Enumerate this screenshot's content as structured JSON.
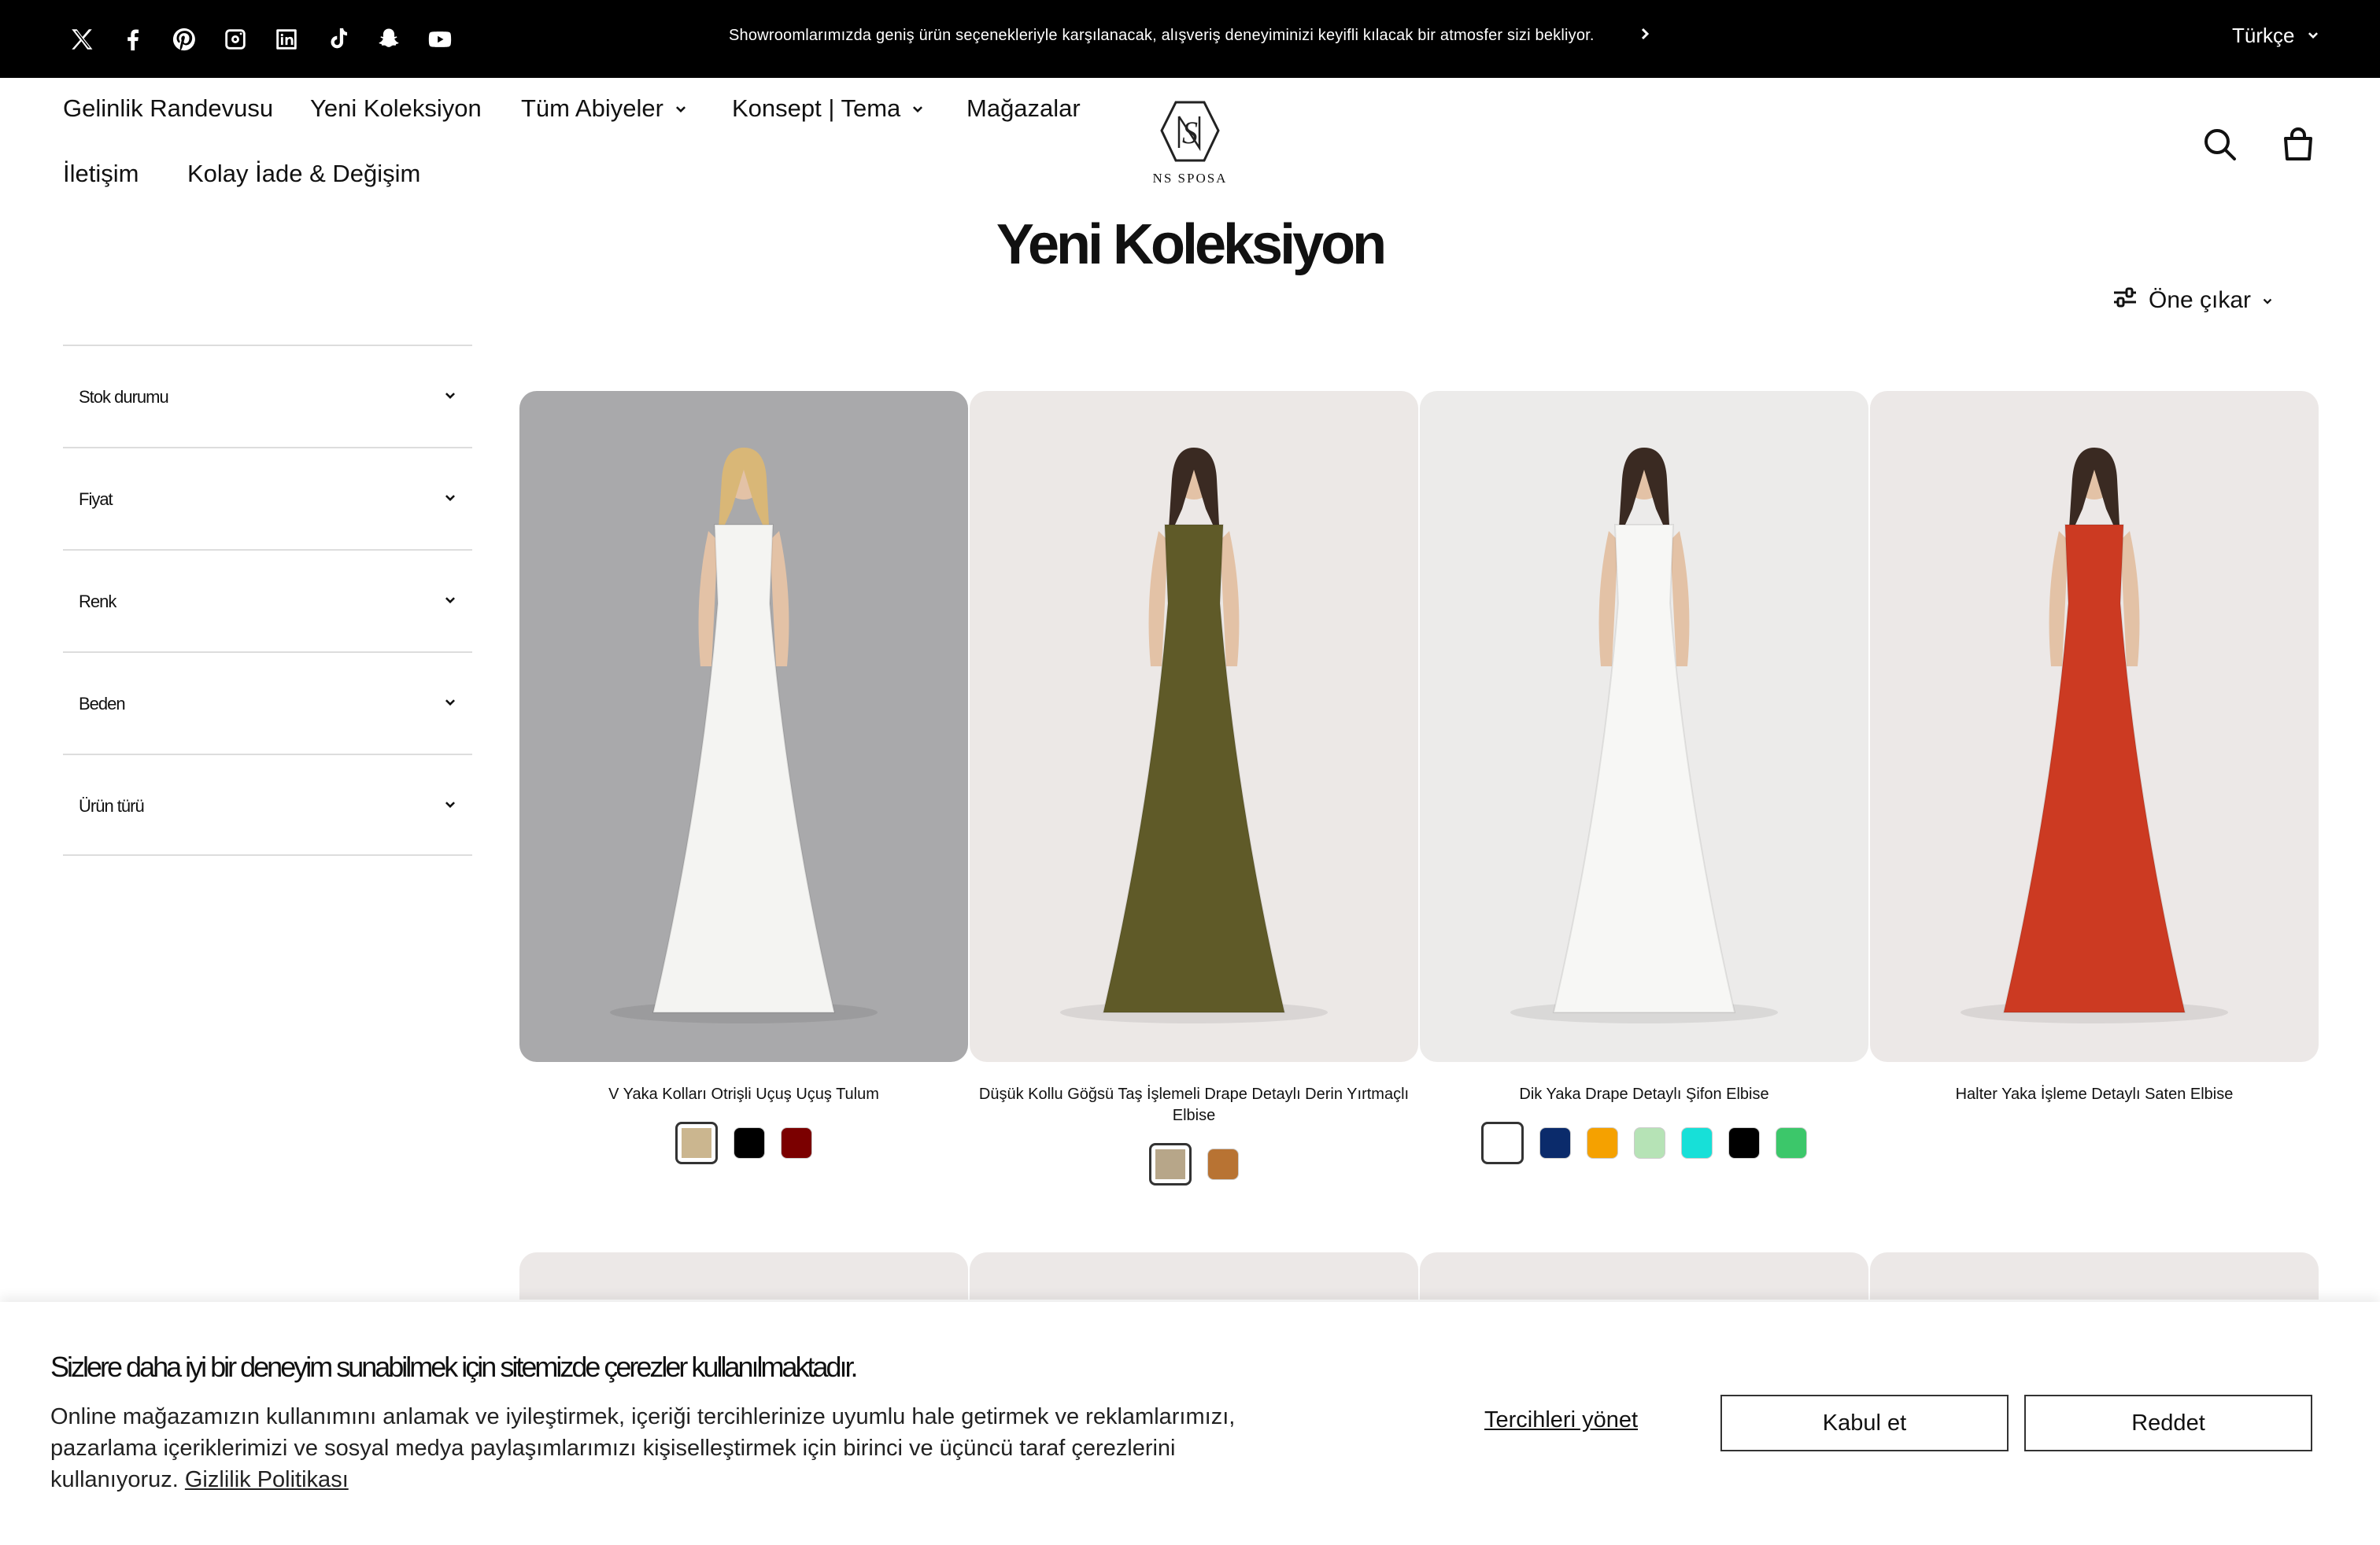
{
  "announcement": {
    "text": "Showroomlarımızda geniş ürün seçenekleriyle karşılanacak, alışveriş deneyiminizi keyifli kılacak bir atmosfer sizi bekliyor.",
    "language": "Türkçe"
  },
  "social": [
    "x-icon",
    "facebook-icon",
    "pinterest-icon",
    "instagram-icon",
    "linkedin-icon",
    "tiktok-icon",
    "snapchat-icon",
    "youtube-icon"
  ],
  "nav": {
    "items": [
      {
        "label": "Gelinlik Randevusu"
      },
      {
        "label": "Yeni Koleksiyon"
      },
      {
        "label": "Tüm Abiyeler"
      },
      {
        "label": "Konsept | Tema"
      },
      {
        "label": "Mağazalar"
      },
      {
        "label": "İletişim"
      },
      {
        "label": "Kolay İade & Değişim"
      }
    ]
  },
  "logo": {
    "text": "NS SPOSA"
  },
  "page": {
    "title": "Yeni Koleksiyon",
    "sort_label": "Öne çıkar"
  },
  "filters": [
    "Stok durumu",
    "Fiyat",
    "Renk",
    "Beden",
    "Ürün türü"
  ],
  "products": [
    {
      "title": "V Yaka Kolları Otrişli Uçuş Uçuş Tulum",
      "swatches": [
        "#cbb68f",
        "#000000",
        "#7b0000"
      ],
      "dress_color": "#f4f4f2",
      "bg": "#a9a9ab"
    },
    {
      "title": "Düşük Kollu Göğsü Taş İşlemeli Drape Detaylı Derin Yırtmaçlı Elbise",
      "swatches": [
        "#b7a689",
        "#b87333"
      ],
      "dress_color": "#5f5a28",
      "bg": "#ece8e6"
    },
    {
      "title": "Dik Yaka Drape Detaylı Şifon Elbise",
      "swatches": [
        "#ffffff",
        "#0b2b6b",
        "#f5a100",
        "#b6e3b6",
        "#17e0d8",
        "#000000",
        "#3cc76a"
      ],
      "dress_color": "#f7f7f5",
      "bg": "#ecebea"
    },
    {
      "title": "Halter Yaka İşleme Detaylı Saten Elbise",
      "swatches": [],
      "dress_color": "#cc3a22",
      "bg": "#ece8e7"
    }
  ],
  "cookie": {
    "title": "Sizlere daha iyi bir deneyim sunabilmek için sitemizde çerezler kullanılmaktadır.",
    "body": "Online mağazamızın kullanımını anlamak ve iyileştirmek, içeriği tercihlerinize uyumlu hale getirmek ve reklamlarımızı, pazarlama içeriklerimizi ve sosyal medya paylaşımlarımızı kişiselleştirmek için birinci ve üçüncü taraf çerezlerini kullanıyoruz.",
    "privacy_link": "Gizlilik Politikası",
    "manage": "Tercihleri yönet",
    "accept": "Kabul et",
    "reject": "Reddet"
  }
}
